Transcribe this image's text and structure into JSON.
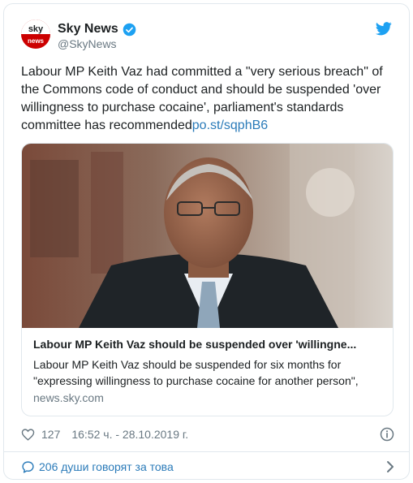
{
  "author": {
    "name": "Sky News",
    "handle": "@SkyNews",
    "avatar_text_top": "sky",
    "avatar_text_bottom": "news",
    "verified": true
  },
  "tweet": {
    "text": "Labour MP Keith Vaz had committed a \"very serious breach\" of the Commons code of conduct and should be suspended 'over willingness to purchase cocaine', parliament's standards committee has recommended",
    "link": "po.st/sqphB6"
  },
  "card": {
    "title": "Labour MP Keith Vaz should be suspended over 'willingne...",
    "description": "Labour MP Keith Vaz should be suspended for six months for \"expressing willingness to purchase cocaine for another person\",",
    "domain": "news.sky.com"
  },
  "meta": {
    "likes": "127",
    "timestamp": "16:52 ч. - 28.10.2019 г."
  },
  "conversation": {
    "label": "206 души говорят за това"
  },
  "colors": {
    "link": "#2b7bb9",
    "muted": "#697882",
    "brand_red": "#cc0000",
    "twitter_blue": "#1da1f2"
  },
  "icons": [
    "sky-news-avatar",
    "verified-badge-icon",
    "twitter-bird-icon",
    "heart-icon",
    "info-icon",
    "reply-bubble-icon",
    "chevron-right-icon"
  ]
}
